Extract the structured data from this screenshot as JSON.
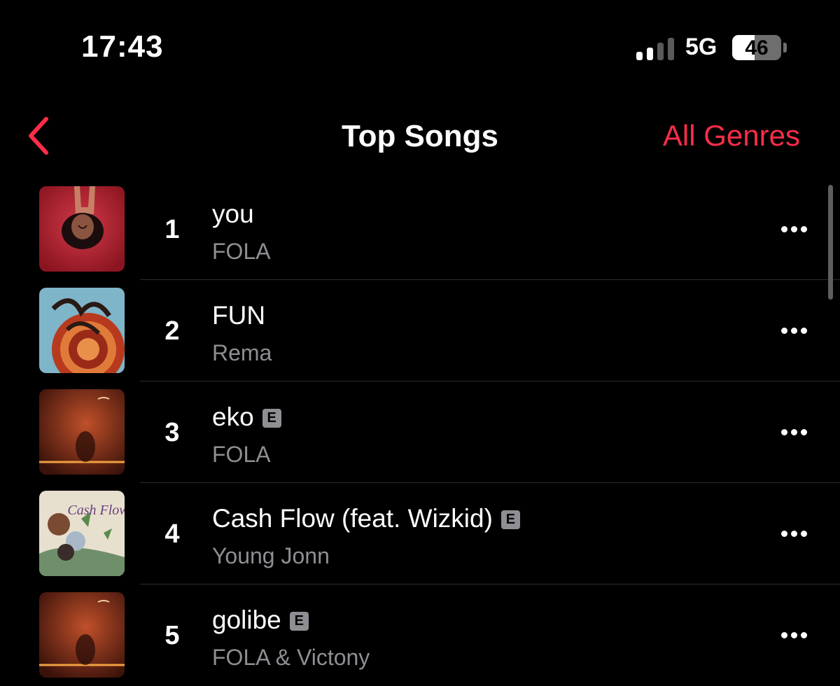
{
  "status_bar": {
    "time": "17:43",
    "network": "5G",
    "battery": "46",
    "battery_level": 0.46
  },
  "nav": {
    "title": "Top Songs",
    "right_action": "All Genres",
    "back_icon": "chevron-left-icon",
    "accent_color": "#fa2d48"
  },
  "songs": [
    {
      "rank": "1",
      "title": "you",
      "artist": "FOLA",
      "explicit": false,
      "explicit_label": ""
    },
    {
      "rank": "2",
      "title": "FUN",
      "artist": "Rema",
      "explicit": false,
      "explicit_label": ""
    },
    {
      "rank": "3",
      "title": "eko",
      "artist": "FOLA",
      "explicit": true,
      "explicit_label": "E"
    },
    {
      "rank": "4",
      "title": "Cash Flow (feat. Wizkid)",
      "artist": "Young Jonn",
      "explicit": true,
      "explicit_label": "E"
    },
    {
      "rank": "5",
      "title": "golibe",
      "artist": "FOLA & Victony",
      "explicit": true,
      "explicit_label": "E"
    }
  ],
  "artwork_text": {
    "cash_flow": "Cash Flow"
  }
}
